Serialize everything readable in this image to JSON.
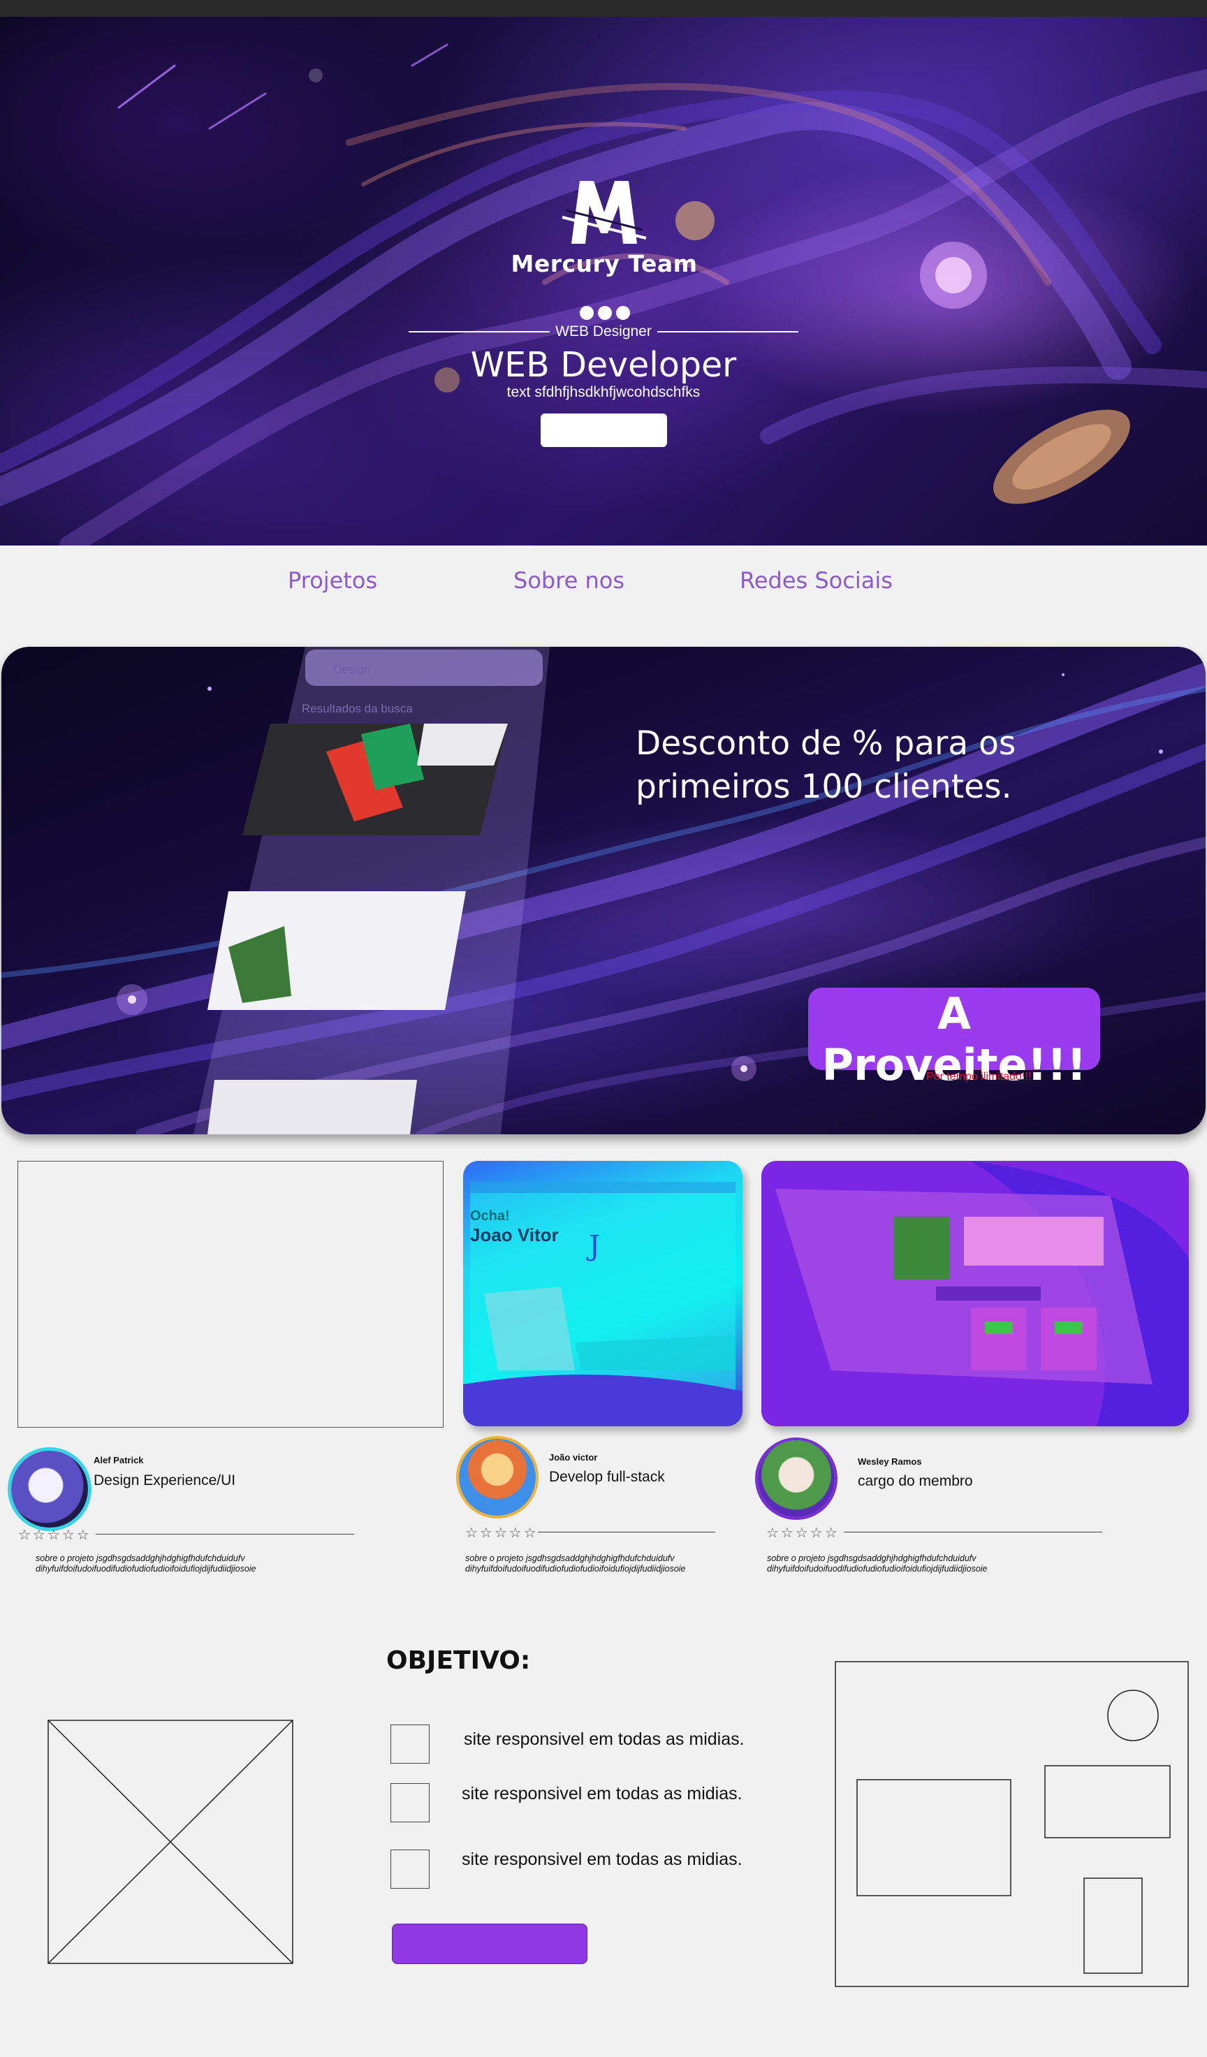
{
  "hero": {
    "brand": "Mercury Team",
    "subtitle": "WEB Designer",
    "title": "WEB Developer",
    "text": "text sfdhfjhsdkhfjwcohdschfks"
  },
  "nav": {
    "items": [
      "Projetos",
      "Sobre nos",
      "Redes Sociais"
    ]
  },
  "promo": {
    "headline_line1": "Desconto de % para os",
    "headline_line2": "primeiros 100 clientes.",
    "button_label": "A Proveite!!!",
    "note": "Por tempo ilimitado!!!",
    "phone_search": "Design",
    "phone_results": "Resultados da busca"
  },
  "members": [
    {
      "name": "Alef Patrick",
      "role": "Design Experience/UI",
      "stars": "☆☆☆☆☆",
      "about_line1": "sobre o projeto jsgdhsgdsaddghjhdghigfhdufchduidufv",
      "about_line2": "dihyfuifdoifudoifuodifudiofudiofudioifoidufiojdijfudiidjiosoie"
    },
    {
      "name": "João victor",
      "role": "Develop full-stack",
      "stars": "☆☆☆☆☆",
      "about_line1": "sobre o projeto jsgdhsgdsaddghjhdghigfhdufchduidufv",
      "about_line2": "dihyfuifdoifudoifuodifudiofudiofudioifoidufiojdijfudiidjiosoie"
    },
    {
      "name": "Wesley Ramos",
      "role": "cargo do membro",
      "stars": "☆☆☆☆☆",
      "about_line1": "sobre o projeto jsgdhsgdsaddghjhdghigfhdufchduidufv",
      "about_line2": "dihyfuifdoifudoifuodifudiofudiofudioifoidufiojdijfudiidjiosoie"
    }
  ],
  "objective": {
    "title": "OBJETIVO:",
    "items": [
      "site responsivel em todas as midias.",
      "site responsivel em todas as midias.",
      "site responsivel em todas as midias."
    ]
  },
  "colors": {
    "accent": "#9a3bef",
    "nav_text": "#8d5ac9",
    "note": "#e0102c"
  }
}
